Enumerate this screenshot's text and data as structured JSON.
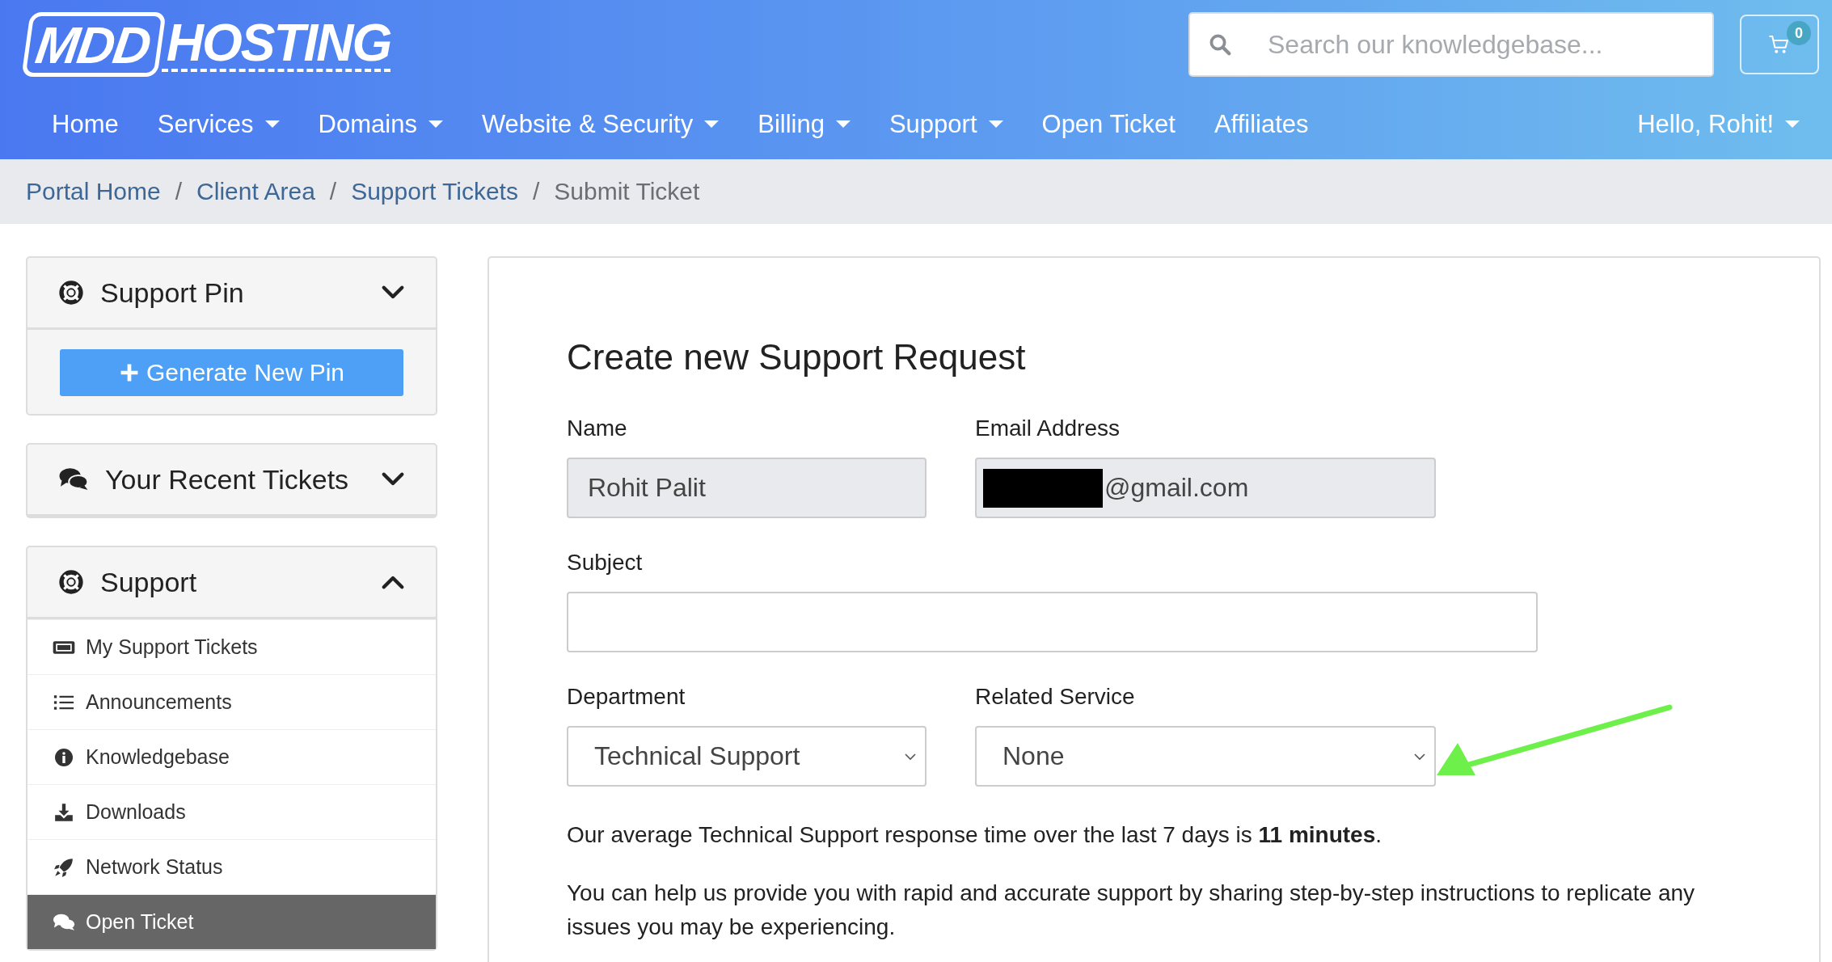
{
  "header": {
    "logo": {
      "boxed": "MDD",
      "rest": "HOSTING"
    },
    "search": {
      "placeholder": "Search our knowledgebase..."
    },
    "cart": {
      "count": "0"
    }
  },
  "nav": {
    "items": [
      {
        "label": "Home",
        "dropdown": false
      },
      {
        "label": "Services",
        "dropdown": true
      },
      {
        "label": "Domains",
        "dropdown": true
      },
      {
        "label": "Website & Security",
        "dropdown": true
      },
      {
        "label": "Billing",
        "dropdown": true
      },
      {
        "label": "Support",
        "dropdown": true
      },
      {
        "label": "Open Ticket",
        "dropdown": false
      },
      {
        "label": "Affiliates",
        "dropdown": false
      }
    ],
    "user": {
      "label": "Hello, Rohit!",
      "dropdown": true
    }
  },
  "breadcrumb": [
    {
      "label": "Portal Home",
      "link": true
    },
    {
      "separator_before": "/",
      "label": "Client Area",
      "link": true
    },
    {
      "separator_before": "/",
      "label": "Support Tickets",
      "link": true
    },
    {
      "separator_before": "/",
      "label": "Submit Ticket",
      "link": false
    }
  ],
  "sidebar": {
    "panels": [
      {
        "title": "Support Pin",
        "expanded": false,
        "button": "Generate New Pin"
      },
      {
        "title": "Your Recent Tickets",
        "expanded": false
      },
      {
        "title": "Support",
        "expanded": true,
        "items": [
          {
            "label": "My Support Tickets",
            "selected": false
          },
          {
            "label": "Announcements",
            "selected": false
          },
          {
            "label": "Knowledgebase",
            "selected": false
          },
          {
            "label": "Downloads",
            "selected": false
          },
          {
            "label": "Network Status",
            "selected": false
          },
          {
            "label": "Open Ticket",
            "selected": true
          }
        ]
      }
    ]
  },
  "form": {
    "title": "Create new Support Request",
    "name": {
      "label": "Name",
      "value": "Rohit Palit"
    },
    "email": {
      "label": "Email Address",
      "value": "@gmail.com",
      "redacted": true
    },
    "subject": {
      "label": "Subject"
    },
    "department": {
      "label": "Department",
      "value": "Technical Support"
    },
    "service": {
      "label": "Related Service",
      "value": "None"
    },
    "notes": [
      "Our average Technical Support response time over the last 7 days is **11 minutes**.",
      "You can help us provide you with rapid and accurate support by sharing step-by-step instructions to replicate any issues you may be experiencing."
    ]
  }
}
